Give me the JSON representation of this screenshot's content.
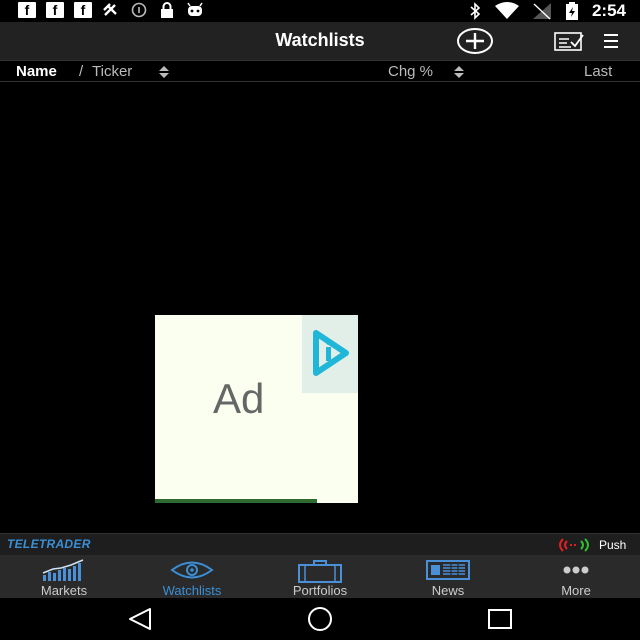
{
  "status_bar": {
    "time": "2:54",
    "left_icons": [
      "facebook-icon",
      "facebook-icon",
      "facebook-icon",
      "satellite-icon",
      "info-icon",
      "lock-icon",
      "android-icon"
    ],
    "right_icons": [
      "bluetooth-icon",
      "wifi-icon",
      "signal-icon",
      "battery-icon"
    ]
  },
  "toolbar": {
    "title": "Watchlists",
    "add_icon": "add-circle-icon",
    "edit_icon": "edit-list-icon",
    "menu_icon": "menu-icon"
  },
  "columns": {
    "name": "Name",
    "separator": "/",
    "ticker": "Ticker",
    "change": "Chg %",
    "last": "Last"
  },
  "ad": {
    "label": "Ad"
  },
  "brand": {
    "name": "TELETRADER",
    "push_label": "Push"
  },
  "tabs": [
    {
      "label": "Markets",
      "icon": "chart-icon",
      "active": false
    },
    {
      "label": "Watchlists",
      "icon": "eye-icon",
      "active": true
    },
    {
      "label": "Portfolios",
      "icon": "briefcase-icon",
      "active": false
    },
    {
      "label": "News",
      "icon": "newspaper-icon",
      "active": false
    },
    {
      "label": "More",
      "icon": "more-dots-icon",
      "active": false
    }
  ],
  "colors": {
    "accent": "#3a8fd6",
    "toolbar": "#222222",
    "tabbar": "#2a2a2a",
    "push_red": "#e02020",
    "push_green": "#30c030"
  }
}
